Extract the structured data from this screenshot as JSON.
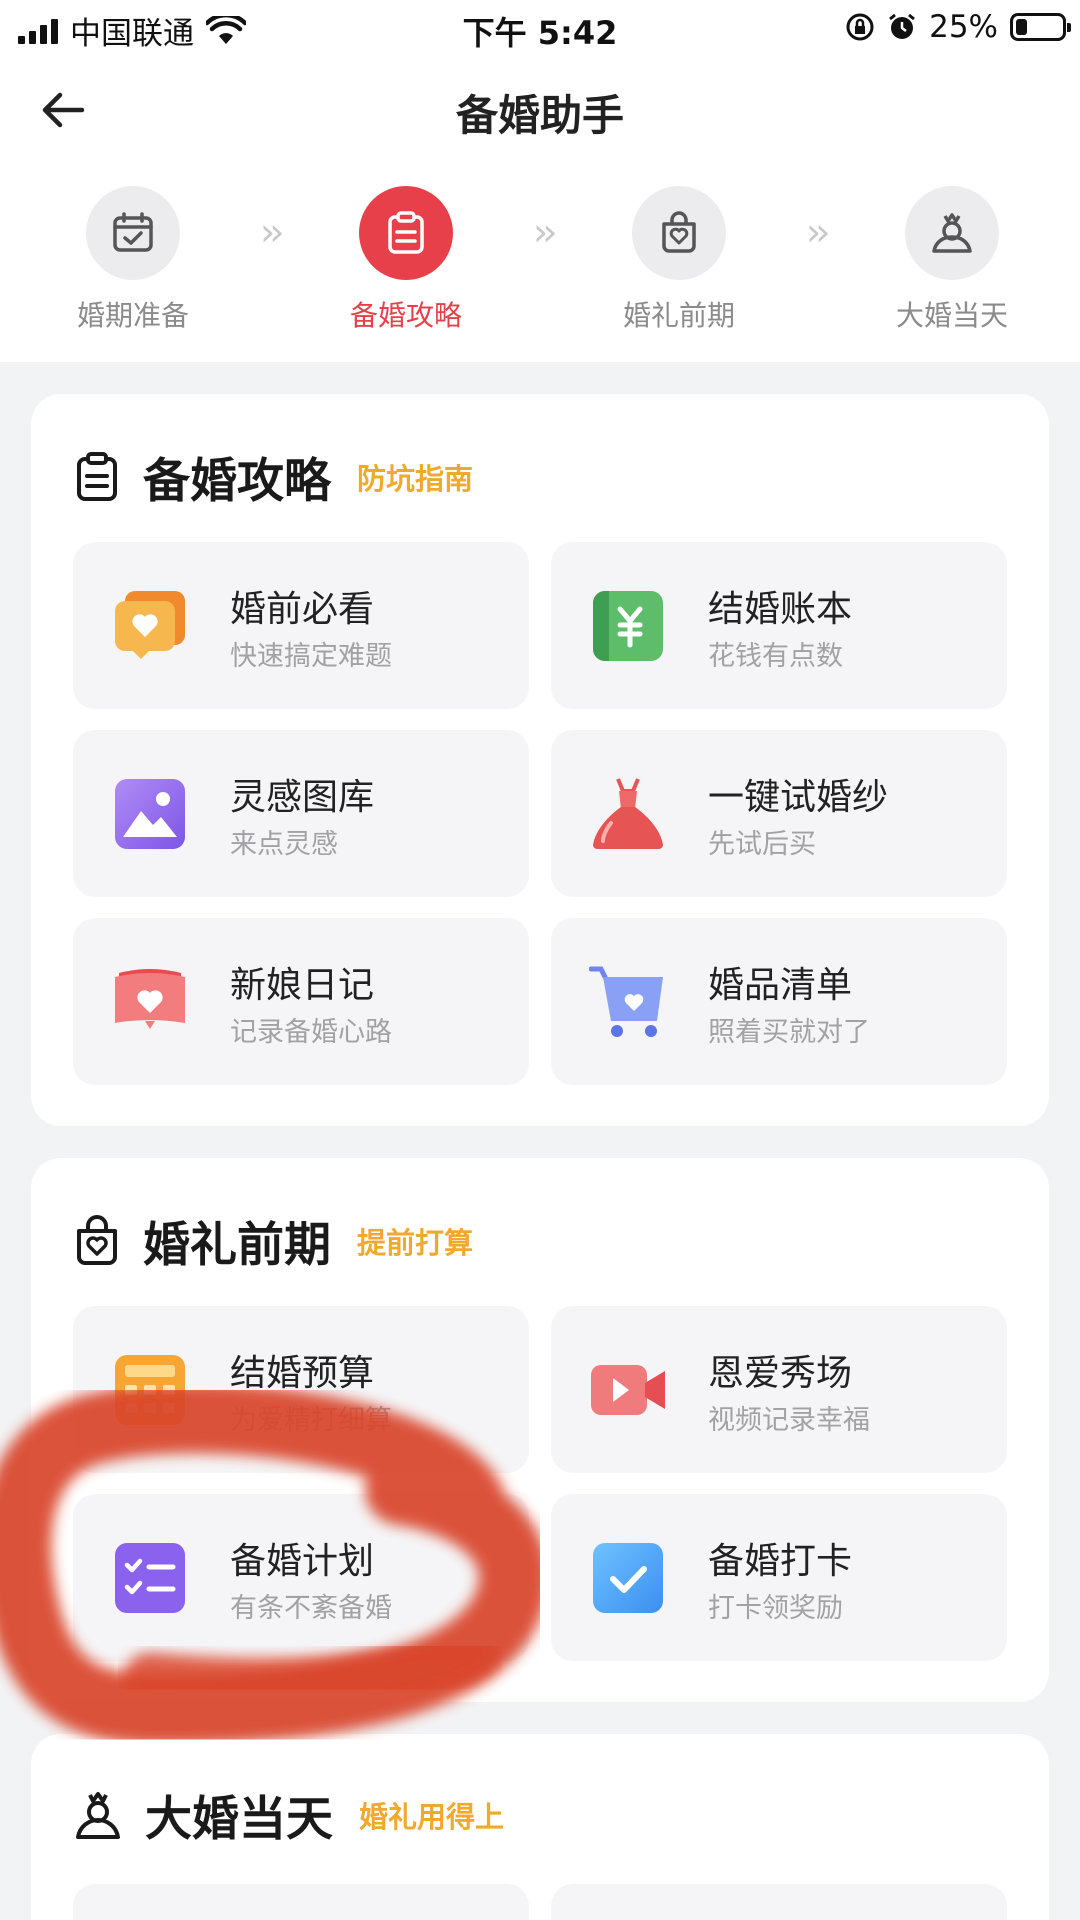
{
  "status_bar": {
    "carrier": "中国联通",
    "time": "下午 5:42",
    "battery_pct": "25%",
    "battery_level": 0.25
  },
  "header": {
    "title": "备婚助手"
  },
  "steps": [
    {
      "label": "婚期准备",
      "icon": "calendar-check-icon",
      "active": false
    },
    {
      "label": "备婚攻略",
      "icon": "clipboard-icon",
      "active": true
    },
    {
      "label": "婚礼前期",
      "icon": "heart-bag-icon",
      "active": false
    },
    {
      "label": "大婚当天",
      "icon": "bride-icon",
      "active": false
    }
  ],
  "sections": [
    {
      "title": "备婚攻略",
      "tag": "防坑指南",
      "icon": "clipboard-icon",
      "items": [
        {
          "title": "婚前必看",
          "subtitle": "快速搞定难题",
          "icon": "heart-chat-icon"
        },
        {
          "title": "结婚账本",
          "subtitle": "花钱有点数",
          "icon": "yuan-ledger-icon"
        },
        {
          "title": "灵感图库",
          "subtitle": "来点灵感",
          "icon": "gallery-icon"
        },
        {
          "title": "一键试婚纱",
          "subtitle": "先试后买",
          "icon": "wedding-dress-icon"
        },
        {
          "title": "新娘日记",
          "subtitle": "记录备婚心路",
          "icon": "heart-diary-icon"
        },
        {
          "title": "婚品清单",
          "subtitle": "照着买就对了",
          "icon": "shopping-cart-icon"
        }
      ]
    },
    {
      "title": "婚礼前期",
      "tag": "提前打算",
      "icon": "heart-bag-icon",
      "items": [
        {
          "title": "结婚预算",
          "subtitle": "为爱精打细算",
          "icon": "calculator-icon"
        },
        {
          "title": "恩爱秀场",
          "subtitle": "视频记录幸福",
          "icon": "video-camera-icon"
        },
        {
          "title": "备婚计划",
          "subtitle": "有条不紊备婚",
          "icon": "checklist-icon"
        },
        {
          "title": "备婚打卡",
          "subtitle": "打卡领奖励",
          "icon": "check-in-icon"
        }
      ]
    },
    {
      "title": "大婚当天",
      "tag": "婚礼用得上",
      "icon": "bride-icon",
      "items": []
    }
  ],
  "colors": {
    "accent_red": "#e8404a",
    "tag_orange": "#f0a92d"
  }
}
